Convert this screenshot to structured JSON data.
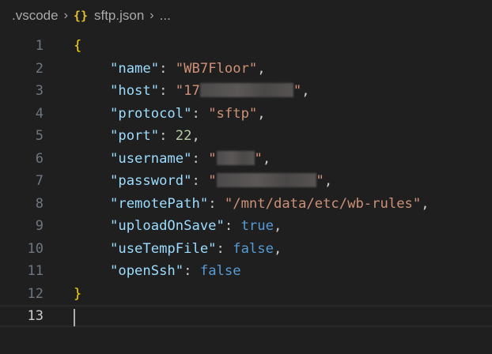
{
  "breadcrumb": {
    "folder": ".vscode",
    "file_icon": "{}",
    "file": "sftp.json",
    "more": "..."
  },
  "editor": {
    "lines": {
      "l1": "1",
      "l2": "2",
      "l3": "3",
      "l4": "4",
      "l5": "5",
      "l6": "6",
      "l7": "7",
      "l8": "8",
      "l9": "9",
      "l10": "10",
      "l11": "11",
      "l12": "12",
      "l13": "13"
    },
    "config": {
      "name_key": "\"name\"",
      "name_val": "\"WB7Floor\"",
      "host_key": "\"host\"",
      "host_val_visible": "\"17",
      "protocol_key": "\"protocol\"",
      "protocol_val": "\"sftp\"",
      "port_key": "\"port\"",
      "port_val": "22",
      "username_key": "\"username\"",
      "password_key": "\"password\"",
      "remotePath_key": "\"remotePath\"",
      "remotePath_val": "\"/mnt/data/etc/wb-rules\"",
      "uploadOnSave_key": "\"uploadOnSave\"",
      "uploadOnSave_val": "true",
      "useTempFile_key": "\"useTempFile\"",
      "useTempFile_val": "false",
      "openSsh_key": "\"openSsh\"",
      "openSsh_val": "false"
    },
    "syntax_colors": {
      "brace": "#ffd700",
      "key": "#9cdcfe",
      "string": "#ce9178",
      "number": "#b5cea8",
      "keyword": "#569cd6"
    }
  }
}
